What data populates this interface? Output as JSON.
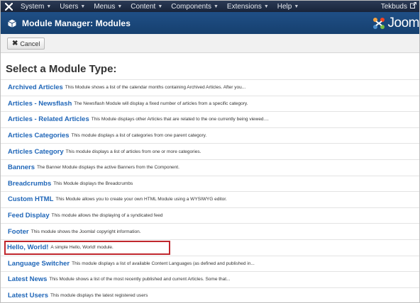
{
  "topbar": {
    "menus": [
      {
        "label": "System"
      },
      {
        "label": "Users"
      },
      {
        "label": "Menus"
      },
      {
        "label": "Content"
      },
      {
        "label": "Components"
      },
      {
        "label": "Extensions"
      },
      {
        "label": "Help"
      }
    ],
    "user": "Tekbuds",
    "logo_icon": "joomla-x-icon",
    "external_icon": "external-link-icon"
  },
  "header": {
    "title": "Module Manager: Modules",
    "brand": "Joom",
    "module_icon": "cube-icon"
  },
  "toolbar": {
    "cancel_label": "Cancel",
    "cancel_icon": "close-icon"
  },
  "page": {
    "heading": "Select a Module Type:"
  },
  "modules": [
    {
      "name": "Archived Articles",
      "description": "This Module shows a list of the calendar months containing Archived Articles. After you..."
    },
    {
      "name": "Articles - Newsflash",
      "description": "The Newsflash Module will display a fixed number of articles from a specific category."
    },
    {
      "name": "Articles - Related Articles",
      "description": "This Module displays other Articles that are related to the one currently being viewed...."
    },
    {
      "name": "Articles Categories",
      "description": "This module displays a list of categories from one parent category."
    },
    {
      "name": "Articles Category",
      "description": "This module displays a list of articles from one or more categories."
    },
    {
      "name": "Banners",
      "description": "The Banner Module displays the active Banners from the Component."
    },
    {
      "name": "Breadcrumbs",
      "description": "This Module displays the Breadcrumbs"
    },
    {
      "name": "Custom HTML",
      "description": "This Module allows you to create your own HTML Module using a WYSIWYG editor."
    },
    {
      "name": "Feed Display",
      "description": "This module allows the displaying of a syndicated feed"
    },
    {
      "name": "Footer",
      "description": "This module shows the Joomla! copyright information."
    },
    {
      "name": "Hello, World!",
      "description": "A simple Hello, World! module."
    },
    {
      "name": "Language Switcher",
      "description": "This module displays a list of available Content Languages (as defined and published in..."
    },
    {
      "name": "Latest News",
      "description": "This Module shows a list of the most recently published and current Articles. Some that..."
    },
    {
      "name": "Latest Users",
      "description": "This module displays the latest registered users"
    }
  ],
  "colors": {
    "topbar": "#1c2940",
    "header": "#1b4679",
    "link": "#1f66b8",
    "highlight": "#c0272d"
  }
}
